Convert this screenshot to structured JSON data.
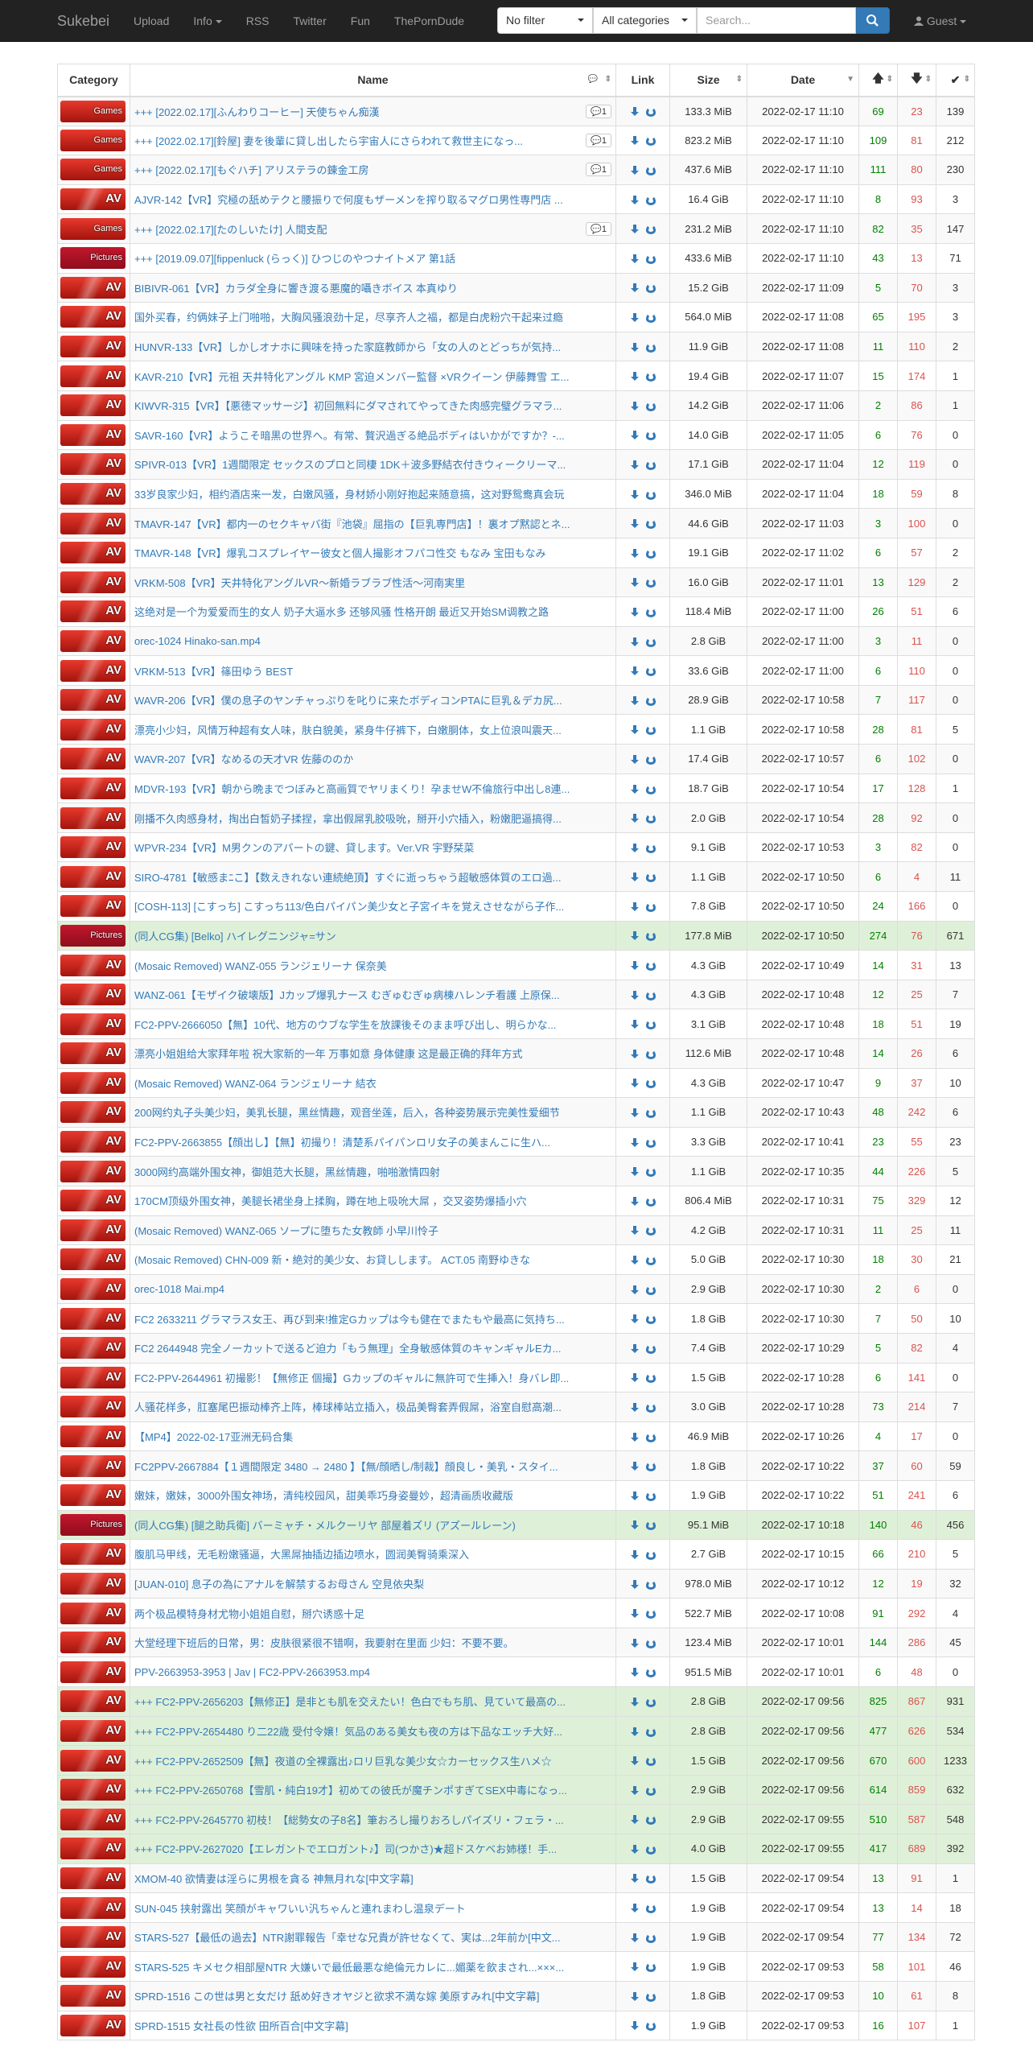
{
  "nav": {
    "brand": "Sukebei",
    "upload": "Upload",
    "info": "Info",
    "rss": "RSS",
    "twitter": "Twitter",
    "fun": "Fun",
    "tpd": "ThePornDude",
    "filter": "No filter",
    "categories": "All categories",
    "search_placeholder": "Search...",
    "guest": "Guest"
  },
  "headers": {
    "category": "Category",
    "name": "Name",
    "link": "Link",
    "size": "Size",
    "date": "Date"
  },
  "rows": [
    {
      "cat": "Games",
      "name": "+++ [2022.02.17][ふんわりコーヒー] 天使ちゃん痴漢",
      "c": "1",
      "size": "133.3 MiB",
      "date": "2022-02-17 11:10",
      "s": "69",
      "l": "23",
      "d": "139"
    },
    {
      "cat": "Games",
      "name": "+++ [2022.02.17][鈴屋] 妻を後輩に貸し出したら宇宙人にさらわれて救世主になっ...",
      "c": "1",
      "size": "823.2 MiB",
      "date": "2022-02-17 11:10",
      "s": "109",
      "l": "81",
      "d": "212"
    },
    {
      "cat": "Games",
      "name": "+++ [2022.02.17][もぐハチ] アリステラの錬金工房",
      "c": "1",
      "size": "437.6 MiB",
      "date": "2022-02-17 11:10",
      "s": "111",
      "l": "80",
      "d": "230"
    },
    {
      "cat": "AV",
      "name": "AJVR-142【VR】究極の舐めテクと腰振りで何度もザーメンを搾り取るマグロ男性専門店 ...",
      "size": "16.4 GiB",
      "date": "2022-02-17 11:10",
      "s": "8",
      "l": "93",
      "d": "3"
    },
    {
      "cat": "Games",
      "name": "+++ [2022.02.17][たのしいたけ] 人間支配",
      "c": "1",
      "size": "231.2 MiB",
      "date": "2022-02-17 11:10",
      "s": "82",
      "l": "35",
      "d": "147"
    },
    {
      "cat": "Pictures",
      "name": "+++ [2019.09.07][fippenluck (らっく)] ひつじのやつナイトメア 第1話",
      "size": "433.6 MiB",
      "date": "2022-02-17 11:10",
      "s": "43",
      "l": "13",
      "d": "71"
    },
    {
      "cat": "AV",
      "name": "BIBIVR-061【VR】カラダ全身に響き渡る悪魔的囁きボイス 本真ゆり",
      "size": "15.2 GiB",
      "date": "2022-02-17 11:09",
      "s": "5",
      "l": "70",
      "d": "3"
    },
    {
      "cat": "AV",
      "name": "国外买春，约俩妹子上门啪啪，大胸风骚浪劲十足，尽享齐人之福，都是白虎粉穴干起来过瘾",
      "size": "564.0 MiB",
      "date": "2022-02-17 11:08",
      "s": "65",
      "l": "195",
      "d": "3"
    },
    {
      "cat": "AV",
      "name": "HUNVR-133【VR】しかしオナホに興味を持った家庭教師から「女の人のとどっちが気持...",
      "size": "11.9 GiB",
      "date": "2022-02-17 11:08",
      "s": "11",
      "l": "110",
      "d": "2"
    },
    {
      "cat": "AV",
      "name": "KAVR-210【VR】元祖 天井特化アングル KMP 宮迫メンバー監督 ×VRクイーン 伊藤舞雪 エ...",
      "size": "19.4 GiB",
      "date": "2022-02-17 11:07",
      "s": "15",
      "l": "174",
      "d": "1"
    },
    {
      "cat": "AV",
      "name": "KIWVR-315【VR】【悪徳マッサージ】初回無料にダマされてやってきた肉感完璧グラマラ...",
      "size": "14.2 GiB",
      "date": "2022-02-17 11:06",
      "s": "2",
      "l": "86",
      "d": "1"
    },
    {
      "cat": "AV",
      "name": "SAVR-160【VR】ようこそ暗黒の世界へ。有常、贅沢過ぎる絶品ボディはいかがですか？-...",
      "size": "14.0 GiB",
      "date": "2022-02-17 11:05",
      "s": "6",
      "l": "76",
      "d": "0"
    },
    {
      "cat": "AV",
      "name": "SPIVR-013【VR】1週間限定 セックスのプロと同棲 1DK＋波多野結衣付きウィークリーマ...",
      "size": "17.1 GiB",
      "date": "2022-02-17 11:04",
      "s": "12",
      "l": "119",
      "d": "0"
    },
    {
      "cat": "AV",
      "name": "33岁良家少妇，相约酒店来一发，白嫩风骚，身材娇小刚好抱起来随意搞，这对野鸳鸯真会玩",
      "size": "346.0 MiB",
      "date": "2022-02-17 11:04",
      "s": "18",
      "l": "59",
      "d": "8"
    },
    {
      "cat": "AV",
      "name": "TMAVR-147【VR】都内一のセクキャバ街『池袋』屈指の【巨乳専門店】！裏オプ黙認とネ...",
      "size": "44.6 GiB",
      "date": "2022-02-17 11:03",
      "s": "3",
      "l": "100",
      "d": "0"
    },
    {
      "cat": "AV",
      "name": "TMAVR-148【VR】爆乳コスプレイヤー彼女と個人撮影オフパコ性交 もなみ 宝田もなみ",
      "size": "19.1 GiB",
      "date": "2022-02-17 11:02",
      "s": "6",
      "l": "57",
      "d": "2"
    },
    {
      "cat": "AV",
      "name": "VRKM-508【VR】天井特化アングルVR～新婚ラブラブ性活～河南実里",
      "size": "16.0 GiB",
      "date": "2022-02-17 11:01",
      "s": "13",
      "l": "129",
      "d": "2"
    },
    {
      "cat": "AV",
      "name": "这绝对是一个为爱爱而生的女人 奶子大逼水多 还够风骚 性格开朗 最近又开始SM调教之路",
      "size": "118.4 MiB",
      "date": "2022-02-17 11:00",
      "s": "26",
      "l": "51",
      "d": "6"
    },
    {
      "cat": "AV",
      "name": "orec-1024 Hinako-san.mp4",
      "size": "2.8 GiB",
      "date": "2022-02-17 11:00",
      "s": "3",
      "l": "11",
      "d": "0"
    },
    {
      "cat": "AV",
      "name": "VRKM-513【VR】篠田ゆう BEST",
      "size": "33.6 GiB",
      "date": "2022-02-17 11:00",
      "s": "6",
      "l": "110",
      "d": "0"
    },
    {
      "cat": "AV",
      "name": "WAVR-206【VR】僕の息子のヤンチャっぷりを叱りに来たボディコンPTAに巨乳＆デカ尻...",
      "size": "28.9 GiB",
      "date": "2022-02-17 10:58",
      "s": "7",
      "l": "117",
      "d": "0"
    },
    {
      "cat": "AV",
      "name": "漂亮小少妇，风情万种超有女人味，肤白貌美，紧身牛仔裤下，白嫩胴体，女上位浪叫震天...",
      "size": "1.1 GiB",
      "date": "2022-02-17 10:58",
      "s": "28",
      "l": "81",
      "d": "5"
    },
    {
      "cat": "AV",
      "name": "WAVR-207【VR】なめるの天才VR 佐藤ののか",
      "size": "17.4 GiB",
      "date": "2022-02-17 10:57",
      "s": "6",
      "l": "102",
      "d": "0"
    },
    {
      "cat": "AV",
      "name": "MDVR-193【VR】朝から晩までつぼみと高画質でヤリまくり！孕ませW不倫旅行中出し8連...",
      "size": "18.7 GiB",
      "date": "2022-02-17 10:54",
      "s": "17",
      "l": "128",
      "d": "1"
    },
    {
      "cat": "AV",
      "name": "刚播不久肉感身材，掏出白皙奶子揉捏，拿出假屌乳胶吸吮，掰开小穴插入，粉嫩肥逼搞得...",
      "size": "2.0 GiB",
      "date": "2022-02-17 10:54",
      "s": "28",
      "l": "92",
      "d": "0"
    },
    {
      "cat": "AV",
      "name": "WPVR-234【VR】M男クンのアパートの鍵、貸します。Ver.VR 宇野栞菜",
      "size": "9.1 GiB",
      "date": "2022-02-17 10:53",
      "s": "3",
      "l": "82",
      "d": "0"
    },
    {
      "cat": "AV",
      "name": "SIRO-4781【敏感まﾆこ】【数えきれない連続絶頂】すぐに逝っちゃう超敏感体質のエロ過...",
      "size": "1.1 GiB",
      "date": "2022-02-17 10:50",
      "s": "6",
      "l": "4",
      "d": "11"
    },
    {
      "cat": "AV",
      "name": "[COSH-113] [こすっち] こすっち113/色白パイパン美少女と子宮イキを覚えさせながら子作...",
      "size": "7.8 GiB",
      "date": "2022-02-17 10:50",
      "s": "24",
      "l": "166",
      "d": "0"
    },
    {
      "cat": "Pictures",
      "succ": true,
      "name": "(同人CG集) [Belko] ハイレグニンジャ=サン",
      "size": "177.8 MiB",
      "date": "2022-02-17 10:50",
      "s": "274",
      "l": "76",
      "d": "671"
    },
    {
      "cat": "AV",
      "name": "(Mosaic Removed) WANZ-055 ランジェリーナ 保奈美",
      "size": "4.3 GiB",
      "date": "2022-02-17 10:49",
      "s": "14",
      "l": "31",
      "d": "13"
    },
    {
      "cat": "AV",
      "name": "WANZ-061【モザイク破壊版】Jカップ爆乳ナース むぎゅむぎゅ病棟ハレンチ看護 上原保...",
      "size": "4.3 GiB",
      "date": "2022-02-17 10:48",
      "s": "12",
      "l": "25",
      "d": "7"
    },
    {
      "cat": "AV",
      "name": "FC2-PPV-2666050【無】10代、地方のウブな学生を放課後そのまま呼び出し、明らかな...",
      "size": "3.1 GiB",
      "date": "2022-02-17 10:48",
      "s": "18",
      "l": "51",
      "d": "19"
    },
    {
      "cat": "AV",
      "name": "漂亮小姐姐给大家拜年啦 祝大家新的一年 万事如意 身体健康 这是最正确的拜年方式",
      "size": "112.6 MiB",
      "date": "2022-02-17 10:48",
      "s": "14",
      "l": "26",
      "d": "6"
    },
    {
      "cat": "AV",
      "name": "(Mosaic Removed) WANZ-064 ランジェリーナ 結衣",
      "size": "4.3 GiB",
      "date": "2022-02-17 10:47",
      "s": "9",
      "l": "37",
      "d": "10"
    },
    {
      "cat": "AV",
      "name": "200网约丸子头美少妇，美乳长腿，黑丝情趣，观音坐莲，后入，各种姿势展示完美性爱细节",
      "size": "1.1 GiB",
      "date": "2022-02-17 10:43",
      "s": "48",
      "l": "242",
      "d": "6"
    },
    {
      "cat": "AV",
      "name": "FC2-PPV-2663855【顔出し】【無】初撮り！清楚系パイパンロリ女子の美まんこに生ハ...",
      "size": "3.3 GiB",
      "date": "2022-02-17 10:41",
      "s": "23",
      "l": "55",
      "d": "23"
    },
    {
      "cat": "AV",
      "name": "3000网约高端外围女神，御姐范大长腿，黑丝情趣，啪啪激情四射",
      "size": "1.1 GiB",
      "date": "2022-02-17 10:35",
      "s": "44",
      "l": "226",
      "d": "5"
    },
    {
      "cat": "AV",
      "name": "170CM顶级外围女神，美腿长裙坐身上揉胸，蹲在地上吸吮大屌 ，交叉姿势爆插小穴",
      "size": "806.4 MiB",
      "date": "2022-02-17 10:31",
      "s": "75",
      "l": "329",
      "d": "12"
    },
    {
      "cat": "AV",
      "name": "(Mosaic Removed) WANZ-065 ソープに堕ちた女教師 小早川怜子",
      "size": "4.2 GiB",
      "date": "2022-02-17 10:31",
      "s": "11",
      "l": "25",
      "d": "11"
    },
    {
      "cat": "AV",
      "name": "(Mosaic Removed) CHN-009 新・絶対的美少女、お貸しします。 ACT.05 南野ゆきな",
      "size": "5.0 GiB",
      "date": "2022-02-17 10:30",
      "s": "18",
      "l": "30",
      "d": "21"
    },
    {
      "cat": "AV",
      "name": "orec-1018 Mai.mp4",
      "size": "2.9 GiB",
      "date": "2022-02-17 10:30",
      "s": "2",
      "l": "6",
      "d": "0"
    },
    {
      "cat": "AV",
      "name": "FC2 2633211 グラマラス女王、再び到来!推定Gカップは今も健在でまたもや最高に気持ち...",
      "size": "1.8 GiB",
      "date": "2022-02-17 10:30",
      "s": "7",
      "l": "50",
      "d": "10"
    },
    {
      "cat": "AV",
      "name": "FC2 2644948 完全ノーカットで送るど迫力「もう無理」全身敏感体質のキャンギャルEカ...",
      "size": "7.4 GiB",
      "date": "2022-02-17 10:29",
      "s": "5",
      "l": "82",
      "d": "4"
    },
    {
      "cat": "AV",
      "name": "FC2-PPV-2644961 初撮影！【無修正 個撮】Gカップのギャルに無許可で生挿入！身バレ即...",
      "size": "1.5 GiB",
      "date": "2022-02-17 10:28",
      "s": "6",
      "l": "141",
      "d": "0"
    },
    {
      "cat": "AV",
      "name": "人骚花样多，肛塞尾巴振动棒齐上阵，棒球棒站立插入，极品美臀套弄假屌，浴室自慰高潮...",
      "size": "3.0 GiB",
      "date": "2022-02-17 10:28",
      "s": "73",
      "l": "214",
      "d": "7"
    },
    {
      "cat": "AV",
      "name": "【MP4】2022-02-17亚洲无码合集",
      "size": "46.9 MiB",
      "date": "2022-02-17 10:26",
      "s": "4",
      "l": "17",
      "d": "0"
    },
    {
      "cat": "AV",
      "name": "FC2PPV-2667884【１週間限定 3480 → 2480 】【無/顔晒し/制裁】顔良し・美乳・スタイ...",
      "size": "1.8 GiB",
      "date": "2022-02-17 10:22",
      "s": "37",
      "l": "60",
      "d": "59"
    },
    {
      "cat": "AV",
      "name": "嫩妹，嫩妹，3000外围女神场，清纯校园风，甜美乖巧身姿曼妙，超清画质收藏版",
      "size": "1.9 GiB",
      "date": "2022-02-17 10:22",
      "s": "51",
      "l": "241",
      "d": "6"
    },
    {
      "cat": "Pictures",
      "succ": true,
      "name": "(同人CG集) [腿之助兵衛] バーミャチ・メルクーリヤ 部屋着ズリ (アズールレーン)",
      "size": "95.1 MiB",
      "date": "2022-02-17 10:18",
      "s": "140",
      "l": "46",
      "d": "456"
    },
    {
      "cat": "AV",
      "name": "腹肌马甲线，无毛粉嫩骚逼，大黑屌抽插边插边喷水，圆润美臀骑乘深入",
      "size": "2.7 GiB",
      "date": "2022-02-17 10:15",
      "s": "66",
      "l": "210",
      "d": "5"
    },
    {
      "cat": "AV",
      "name": "[JUAN-010] 息子の為にアナルを解禁するお母さん 空見依央梨",
      "size": "978.0 MiB",
      "date": "2022-02-17 10:12",
      "s": "12",
      "l": "19",
      "d": "32"
    },
    {
      "cat": "AV",
      "name": "两个极品模特身材尤物小姐姐自慰，掰穴诱惑十足",
      "size": "522.7 MiB",
      "date": "2022-02-17 10:08",
      "s": "91",
      "l": "292",
      "d": "4"
    },
    {
      "cat": "AV",
      "name": "大堂经理下班后的日常，男：皮肤很紧很不错啊，我要射在里面 少妇：不要不要。",
      "size": "123.4 MiB",
      "date": "2022-02-17 10:01",
      "s": "144",
      "l": "286",
      "d": "45"
    },
    {
      "cat": "AV",
      "name": "PPV-2663953-3953 | Jav | FC2-PPV-2663953.mp4",
      "size": "951.5 MiB",
      "date": "2022-02-17 10:01",
      "s": "6",
      "l": "48",
      "d": "0"
    },
    {
      "cat": "AV",
      "succ": true,
      "name": "+++ FC2-PPV-2656203【無修正】是非とも肌を交えたい！色白でもち肌、見ていて最高の...",
      "size": "2.8 GiB",
      "date": "2022-02-17 09:56",
      "s": "825",
      "l": "867",
      "d": "931"
    },
    {
      "cat": "AV",
      "succ": true,
      "name": "+++ FC2-PPV-2654480 り二22歳 受付令嬢！気品のある美女も夜の方は下品なエッチ大好...",
      "size": "2.8 GiB",
      "date": "2022-02-17 09:56",
      "s": "477",
      "l": "626",
      "d": "534"
    },
    {
      "cat": "AV",
      "succ": true,
      "name": "+++ FC2-PPV-2652509【無】夜道の全裸露出♪ロリ巨乳な美少女☆カーセックス生ハメ☆",
      "size": "1.5 GiB",
      "date": "2022-02-17 09:56",
      "s": "670",
      "l": "600",
      "d": "1233"
    },
    {
      "cat": "AV",
      "succ": true,
      "name": "+++ FC2-PPV-2650768【雪肌・純白19才】初めての彼氏が魔チンポすぎてSEX中毒になっ...",
      "size": "2.9 GiB",
      "date": "2022-02-17 09:56",
      "s": "614",
      "l": "859",
      "d": "632"
    },
    {
      "cat": "AV",
      "succ": true,
      "name": "+++ FC2-PPV-2645770 初枝！【総勢女の子8名】筆おろし撮りおろしパイズリ・フェラ・...",
      "size": "2.9 GiB",
      "date": "2022-02-17 09:55",
      "s": "510",
      "l": "587",
      "d": "548"
    },
    {
      "cat": "AV",
      "succ": true,
      "name": "+++ FC2-PPV-2627020【エレガントでエロガント♪】司(つかさ)★超ドスケベお姉様！手...",
      "size": "4.0 GiB",
      "date": "2022-02-17 09:55",
      "s": "417",
      "l": "689",
      "d": "392"
    },
    {
      "cat": "AV",
      "name": "XMOM-40 欲情妻は淫らに男根を貪る 神無月れな[中文字幕]",
      "size": "1.5 GiB",
      "date": "2022-02-17 09:54",
      "s": "13",
      "l": "91",
      "d": "1"
    },
    {
      "cat": "AV",
      "name": "SUN-045 挟射露出 笑顔がキャワいい汎ちゃんと連れまわし温泉デート",
      "size": "1.9 GiB",
      "date": "2022-02-17 09:54",
      "s": "13",
      "l": "14",
      "d": "18"
    },
    {
      "cat": "AV",
      "name": "STARS-527【最低の過去】NTR謝罪報告「幸せな兄貴が許せなくて、実は...2年前か[中文...",
      "size": "1.9 GiB",
      "date": "2022-02-17 09:54",
      "s": "77",
      "l": "134",
      "d": "72"
    },
    {
      "cat": "AV",
      "name": "STARS-525 キメセク相部屋NTR 大嫌いで最低最悪な絶倫元カレに...媚薬を飲まされ...×××...",
      "size": "1.9 GiB",
      "date": "2022-02-17 09:53",
      "s": "58",
      "l": "101",
      "d": "46"
    },
    {
      "cat": "AV",
      "name": "SPRD-1516 この世は男と女だけ 舐め好きオヤジと欲求不満な嫁 美原すみれ[中文字幕]",
      "size": "1.8 GiB",
      "date": "2022-02-17 09:53",
      "s": "10",
      "l": "61",
      "d": "8"
    },
    {
      "cat": "AV",
      "name": "SPRD-1515 女社長の性欲 田所百合[中文字幕]",
      "size": "1.9 GiB",
      "date": "2022-02-17 09:53",
      "s": "16",
      "l": "107",
      "d": "1"
    }
  ]
}
